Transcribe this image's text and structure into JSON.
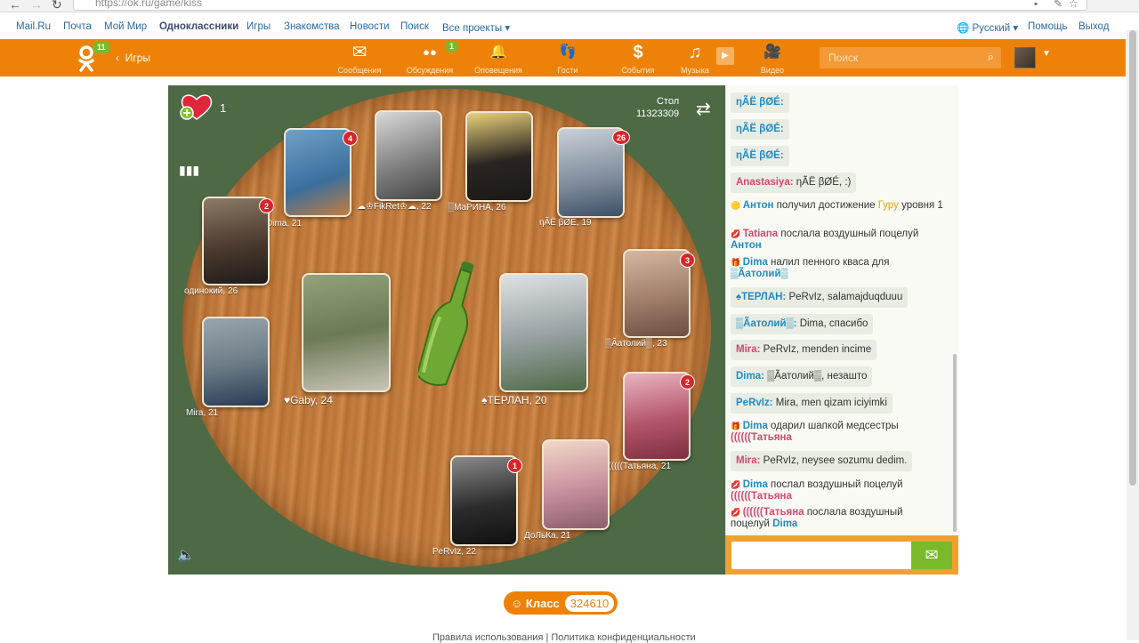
{
  "browser": {
    "url": "https://ok.ru/game/kiss"
  },
  "topbar": {
    "links": [
      "Mail.Ru",
      "Почта",
      "Мой Мир",
      "Одноклассники",
      "Игры",
      "Знакомства",
      "Новости",
      "Поиск",
      "Все проекты ▾"
    ],
    "right": [
      "Русский ▾",
      "Помощь",
      "Выход"
    ]
  },
  "header": {
    "logo_badge": "11",
    "back": "‹",
    "games": "Игры",
    "nav": [
      {
        "icon": "envelope-icon",
        "glyph": "✉",
        "label": "Сообщения"
      },
      {
        "icon": "discussions-icon",
        "glyph": "●●",
        "label": "Обсуждения",
        "badge": "1"
      },
      {
        "icon": "bell-icon",
        "glyph": "🔔",
        "label": "Оповещения"
      },
      {
        "icon": "footprints-icon",
        "glyph": "👣",
        "label": "Гости"
      },
      {
        "icon": "events-icon",
        "glyph": "$",
        "label": "События"
      },
      {
        "icon": "music-icon",
        "glyph": "♫",
        "label": "Музыка"
      },
      {
        "icon": "video-icon",
        "glyph": "🎥",
        "label": "Видео"
      }
    ],
    "search_placeholder": "Поиск"
  },
  "game": {
    "hearts": "1",
    "table_label": "Стол",
    "table_id": "11323309",
    "players": [
      {
        "name": "Dima, 21",
        "count": "4",
        "color": "#3b6f9c"
      },
      {
        "name": "☁♔FikRet♔☁, 22",
        "count": "",
        "color": "#7a7a7a"
      },
      {
        "name": "▒МаРИНА, 26",
        "count": "",
        "color": "#2a2522"
      },
      {
        "name": "ηÃЁ βØÉ, 19",
        "count": "26",
        "color": "#7d8a9a"
      },
      {
        "name": "одинокий, 26",
        "count": "2",
        "color": "#4b3a2e"
      },
      {
        "name": "Mira, 21",
        "count": "",
        "color": "#6e7e88"
      },
      {
        "name": "♥Gaby, 24",
        "count": "",
        "color": "#6c7a55"
      },
      {
        "name": "♠ТЕРЛАН, 20",
        "count": "",
        "color": "#9ba3a6"
      },
      {
        "name": "▒Ãатолий▒, 23",
        "count": "3",
        "color": "#a07e6a"
      },
      {
        "name": "((((((Татьяна, 21",
        "count": "2",
        "color": "#b3556b"
      },
      {
        "name": "PeRvIz, 22",
        "count": "1",
        "color": "#2c2c2c"
      },
      {
        "name": "ДоЛьКа, 21",
        "count": "",
        "color": "#c78f9d"
      }
    ]
  },
  "chat": {
    "messages": [
      {
        "t": "bubble",
        "parts": [
          [
            "n-blue",
            "ηÃЁ βØÉ:"
          ]
        ]
      },
      {
        "t": "bubble",
        "parts": [
          [
            "n-blue",
            "ηÃЁ βØÉ:"
          ]
        ]
      },
      {
        "t": "bubble",
        "parts": [
          [
            "n-blue",
            "ηÃЁ βØÉ:"
          ]
        ]
      },
      {
        "t": "bubble",
        "parts": [
          [
            "n-pink",
            "Anastasiya:"
          ],
          [
            "",
            " ηÃЁ βØÉ, :)"
          ]
        ]
      },
      {
        "t": "sys",
        "icon": "🟡",
        "parts": [
          [
            "n-blue",
            "Антон"
          ],
          [
            "",
            " получил достижение "
          ],
          [
            "n-gold",
            "Гуру"
          ],
          [
            "",
            " уровня 1"
          ]
        ]
      },
      {
        "t": "sys",
        "icon": "💋",
        "parts": [
          [
            "n-pink",
            "Tatiana"
          ],
          [
            "",
            " послала воздушный поцелуй "
          ],
          [
            "n-blue",
            "Антон"
          ]
        ]
      },
      {
        "t": "sys",
        "icon": "🎁",
        "parts": [
          [
            "n-blue",
            "Dima"
          ],
          [
            "",
            " налил пенного кваса для "
          ],
          [
            "n-blue",
            "▒Ãатолий▒"
          ]
        ]
      },
      {
        "t": "bubble",
        "parts": [
          [
            "n-blue",
            "♠ТЕРЛАН:"
          ],
          [
            "",
            " PeRvIz, salamajduqduuu"
          ]
        ]
      },
      {
        "t": "bubble",
        "parts": [
          [
            "n-blue",
            "▒Ãатолий▒:"
          ],
          [
            "",
            " Dima, спасибо"
          ]
        ]
      },
      {
        "t": "bubble",
        "parts": [
          [
            "n-pink",
            "Mira:"
          ],
          [
            "",
            " PeRvIz, menden incime"
          ]
        ]
      },
      {
        "t": "bubble",
        "parts": [
          [
            "n-blue",
            "Dima:"
          ],
          [
            "",
            " ▒Ãатолий▒, незашто"
          ]
        ]
      },
      {
        "t": "bubble",
        "parts": [
          [
            "n-blue",
            "PeRvIz:"
          ],
          [
            "",
            " Mira, men qizam iciyimki"
          ]
        ]
      },
      {
        "t": "sys",
        "icon": "🎁",
        "parts": [
          [
            "n-blue",
            "Dima"
          ],
          [
            "",
            " одарил шапкой медсестры "
          ],
          [
            "n-pink",
            "((((((Татьяна"
          ]
        ]
      },
      {
        "t": "bubble",
        "parts": [
          [
            "n-pink",
            "Mira:"
          ],
          [
            "",
            " PeRvIz, neysee sozumu dedim."
          ]
        ]
      },
      {
        "t": "sys",
        "icon": "💋",
        "parts": [
          [
            "n-blue",
            "Dima"
          ],
          [
            "",
            " послал воздушный поцелуй "
          ],
          [
            "n-pink",
            "((((((Татьяна"
          ]
        ]
      },
      {
        "t": "sys",
        "icon": "💋",
        "parts": [
          [
            "n-pink",
            "((((((Татьяна"
          ],
          [
            "",
            " послала воздушный поцелуй "
          ],
          [
            "n-blue",
            "Dima"
          ]
        ]
      }
    ]
  },
  "klass": {
    "label": "Класс",
    "count": "324610"
  },
  "footer": "Правила использования | Политика конфиденциальности"
}
